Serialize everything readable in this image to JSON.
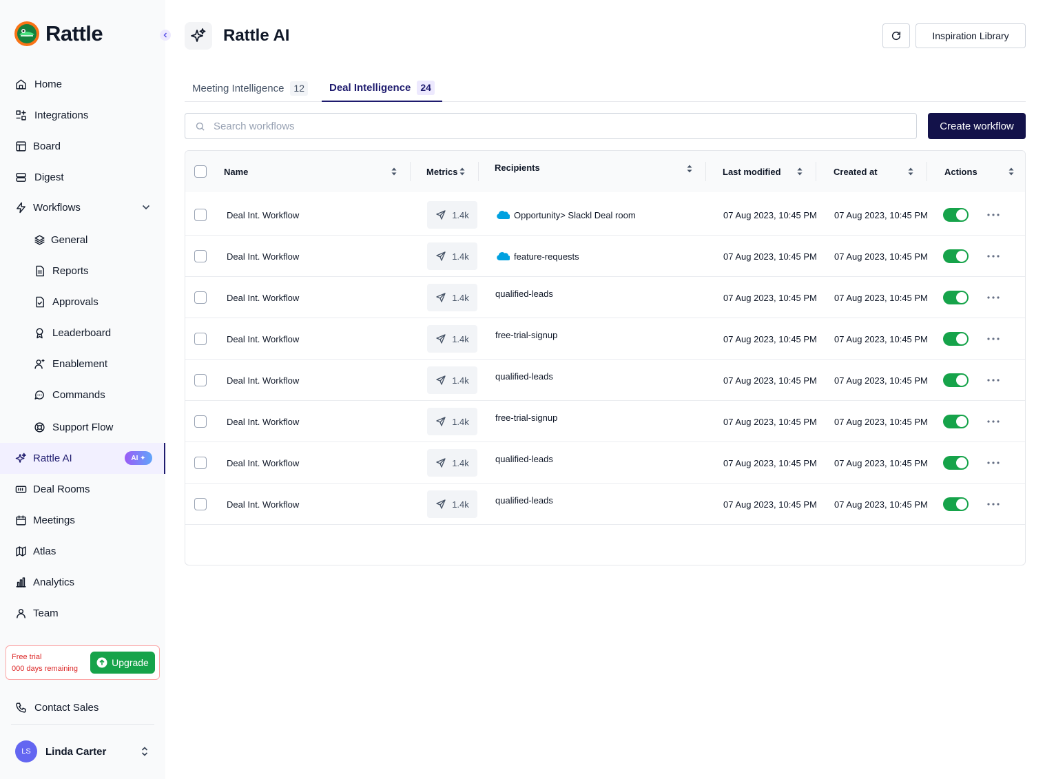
{
  "brand": {
    "name": "Rattle"
  },
  "nav": {
    "items": [
      {
        "label": "Home",
        "icon": "home-icon"
      },
      {
        "label": "Integrations",
        "icon": "integrations-icon"
      },
      {
        "label": "Board",
        "icon": "board-icon"
      },
      {
        "label": "Digest",
        "icon": "digest-icon"
      },
      {
        "label": "Workflows",
        "icon": "lightning-icon"
      },
      {
        "label": "General",
        "icon": "layers-icon"
      },
      {
        "label": "Reports",
        "icon": "report-icon"
      },
      {
        "label": "Approvals",
        "icon": "approval-icon"
      },
      {
        "label": "Leaderboard",
        "icon": "award-icon"
      },
      {
        "label": "Enablement",
        "icon": "user-sparkle-icon"
      },
      {
        "label": "Commands",
        "icon": "chat-icon"
      },
      {
        "label": "Support Flow",
        "icon": "lifebuoy-icon"
      },
      {
        "label": "Rattle AI",
        "icon": "sparkle-icon",
        "badge": "AI"
      },
      {
        "label": "Deal Rooms",
        "icon": "deal-room-icon"
      },
      {
        "label": "Meetings",
        "icon": "calendar-icon"
      },
      {
        "label": "Atlas",
        "icon": "map-icon"
      },
      {
        "label": "Analytics",
        "icon": "bar-chart-icon"
      },
      {
        "label": "Team",
        "icon": "team-icon"
      }
    ]
  },
  "trial": {
    "title": "Free trial",
    "remaining": "000 days remaining",
    "upgrade_label": "Upgrade"
  },
  "contact": {
    "label": "Contact Sales"
  },
  "user": {
    "initials": "LS",
    "name": "Linda Carter"
  },
  "header": {
    "title": "Rattle AI",
    "inspiration_label": "Inspiration Library"
  },
  "tabs": [
    {
      "label": "Meeting Intelligence",
      "count": "12"
    },
    {
      "label": "Deal Intelligence",
      "count": "24"
    }
  ],
  "search": {
    "placeholder": "Search workflows"
  },
  "create_label": "Create workflow",
  "table": {
    "columns": [
      "Name",
      "Metrics",
      "Recipients",
      "Last modified",
      "Created at",
      "Actions"
    ],
    "rows": [
      {
        "name": "Deal Int. Workflow",
        "metric": "1.4k",
        "recipient": "Opportunity> Slackl Deal room",
        "salesforce": true,
        "modified": "07 Aug 2023, 10:45 PM",
        "created": "07 Aug 2023, 10:45 PM"
      },
      {
        "name": "Deal Int. Workflow",
        "metric": "1.4k",
        "recipient": "feature-requests",
        "salesforce": true,
        "modified": "07 Aug 2023, 10:45 PM",
        "created": "07 Aug 2023, 10:45 PM"
      },
      {
        "name": "Deal Int. Workflow",
        "metric": "1.4k",
        "recipient": "qualified-leads",
        "salesforce": false,
        "modified": "07 Aug 2023, 10:45 PM",
        "created": "07 Aug 2023, 10:45 PM"
      },
      {
        "name": "Deal Int. Workflow",
        "metric": "1.4k",
        "recipient": "free-trial-signup",
        "salesforce": false,
        "modified": "07 Aug 2023, 10:45 PM",
        "created": "07 Aug 2023, 10:45 PM"
      },
      {
        "name": "Deal Int. Workflow",
        "metric": "1.4k",
        "recipient": "qualified-leads",
        "salesforce": false,
        "modified": "07 Aug 2023, 10:45 PM",
        "created": "07 Aug 2023, 10:45 PM"
      },
      {
        "name": "Deal Int. Workflow",
        "metric": "1.4k",
        "recipient": "free-trial-signup",
        "salesforce": false,
        "modified": "07 Aug 2023, 10:45 PM",
        "created": "07 Aug 2023, 10:45 PM"
      },
      {
        "name": "Deal Int. Workflow",
        "metric": "1.4k",
        "recipient": "qualified-leads",
        "salesforce": false,
        "modified": "07 Aug 2023, 10:45 PM",
        "created": "07 Aug 2023, 10:45 PM"
      },
      {
        "name": "Deal Int. Workflow",
        "metric": "1.4k",
        "recipient": "qualified-leads",
        "salesforce": false,
        "modified": "07 Aug 2023, 10:45 PM",
        "created": "07 Aug 2023, 10:45 PM"
      }
    ]
  },
  "colors": {
    "accent": "#1e1b6e",
    "primary_button": "#13124a",
    "toggle_on": "#16a34a",
    "trial_text": "#dc2626",
    "salesforce": "#00a1e0"
  }
}
